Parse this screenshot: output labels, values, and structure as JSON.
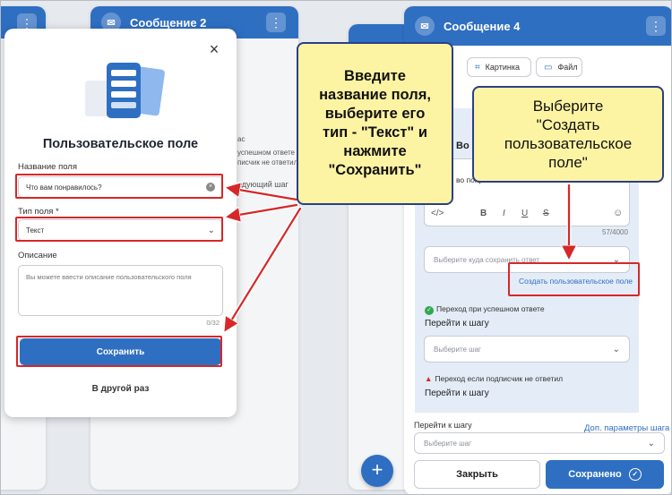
{
  "bg_card_left": {
    "title": "Сообщение 2",
    "partial_texts": [
      "ас",
      "успешном ответе",
      "писчик не ответил",
      "едующий шаг"
    ]
  },
  "message4": {
    "title": "Сообщение 4",
    "chips": [
      {
        "icon": "crop-icon",
        "label": "Картинка"
      },
      {
        "icon": "file-icon",
        "label": "Файл"
      }
    ],
    "partial_heading": "Во",
    "partial_text": "во понравилось?",
    "editor_counter": "57/4000",
    "save_to_placeholder": "Выберите куда сохранить ответ",
    "create_field_link": "Создать пользовательское поле",
    "success": {
      "label": "Переход при успешном ответе",
      "go_to": "Перейти к шагу",
      "placeholder": "Выберите шаг"
    },
    "no_answer": {
      "label": "Переход если подписчик не ответил",
      "go_to": "Перейти к шагу"
    },
    "footer": {
      "go_to": "Перейти к шагу",
      "extra_link": "Доп. параметры шага",
      "placeholder": "Выберите шаг",
      "close_button": "Закрыть",
      "saved_button": "Сохранено"
    }
  },
  "modal": {
    "title": "Пользовательское поле",
    "name_label": "Название поля",
    "name_value": "Что вам понравилось?",
    "type_label": "Тип поля *",
    "type_value": "Текст",
    "desc_label": "Описание",
    "desc_placeholder": "Вы можете ввести описание пользовательского поля",
    "desc_counter": "0/32",
    "save_button": "Сохранить",
    "later_button": "В другой раз"
  },
  "callout_left": {
    "lines": [
      "Введите",
      "название поля,",
      "выберите его",
      "тип - \"Текст\" и",
      "нажмите",
      "\"Сохранить\""
    ]
  },
  "callout_right": {
    "lines": [
      "Выберите",
      "\"Создать",
      "пользовательское",
      "поле\""
    ]
  },
  "colors": {
    "brand": "#2f6fc2",
    "annotation_red": "#d62828",
    "callout_bg": "#fdf4a3"
  }
}
